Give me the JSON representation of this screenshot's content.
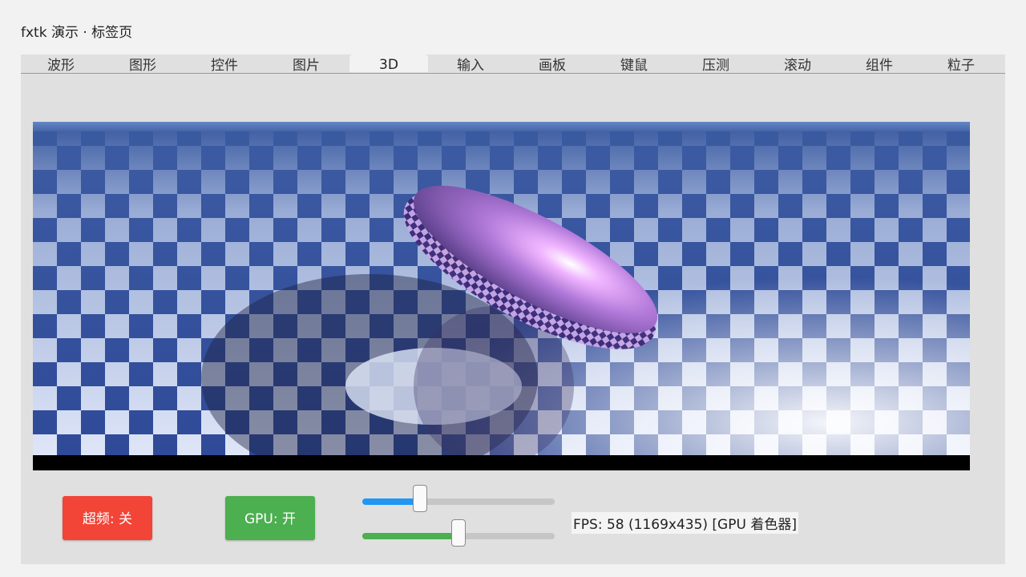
{
  "window": {
    "title": "fxtk 演示 · 标签页"
  },
  "tabs": [
    {
      "label": "波形"
    },
    {
      "label": "图形"
    },
    {
      "label": "控件"
    },
    {
      "label": "图片"
    },
    {
      "label": "3D",
      "active": true
    },
    {
      "label": "输入"
    },
    {
      "label": "画板"
    },
    {
      "label": "键鼠"
    },
    {
      "label": "压测"
    },
    {
      "label": "滚动"
    },
    {
      "label": "组件"
    },
    {
      "label": "粒子"
    }
  ],
  "scene": {
    "description_icon": "3d-render-view",
    "sky_color": "#5b7fbd",
    "checker_dark": "#2f4a98",
    "checker_light": "#dfe6f8",
    "torus_color": "#b47ad9",
    "sphere_color": "#e7a45a"
  },
  "controls": {
    "overclock_button": {
      "label": "超频: 关",
      "color": "#f24437"
    },
    "gpu_button": {
      "label": "GPU: 开",
      "color": "#4caf50"
    },
    "slider1": {
      "value": 0.3,
      "color": "#2196f3"
    },
    "slider2": {
      "value": 0.5,
      "color": "#4caf50"
    },
    "fps_text": "FPS: 58 (1169x435) [GPU 着色器]"
  }
}
